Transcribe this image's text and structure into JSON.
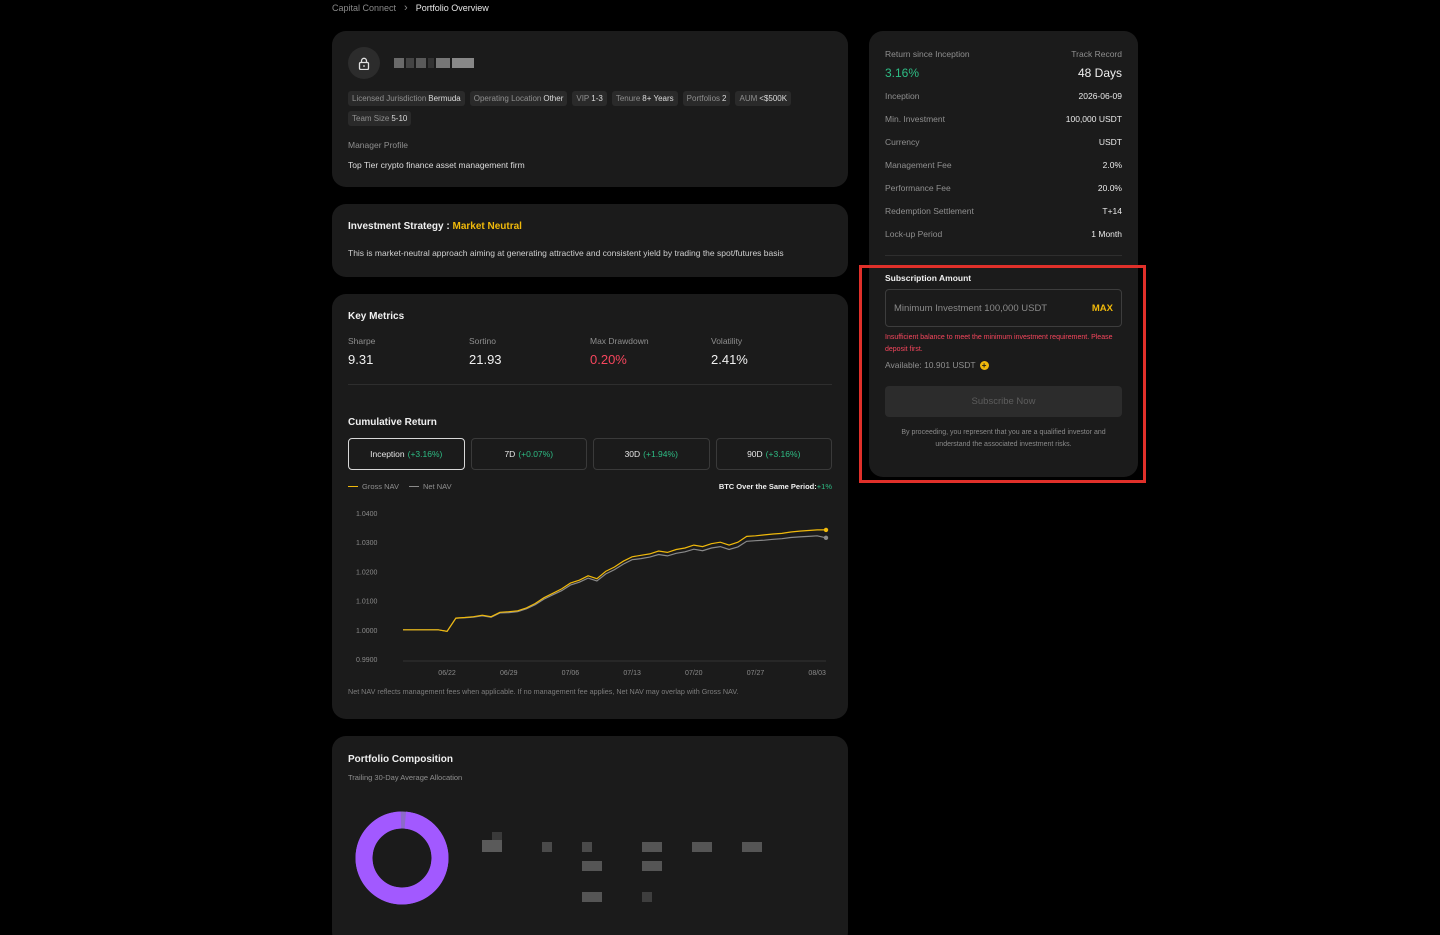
{
  "breadcrumb": {
    "root": "Capital Connect",
    "separator": "›",
    "current": "Portfolio Overview"
  },
  "profile": {
    "tags": [
      {
        "label": "Licensed Jurisdiction",
        "value": "Bermuda"
      },
      {
        "label": "Operating Location",
        "value": "Other"
      },
      {
        "label": "VIP",
        "value": "1-3"
      },
      {
        "label": "Tenure",
        "value": "8+ Years"
      },
      {
        "label": "Portfolios",
        "value": "2"
      },
      {
        "label": "AUM",
        "value": "<$500K"
      },
      {
        "label": "Team Size",
        "value": "5-10"
      }
    ],
    "manager_profile_label": "Manager Profile",
    "manager_profile_text": "Top Tier crypto finance asset management firm"
  },
  "strategy": {
    "title": "Investment Strategy :",
    "name": "Market Neutral",
    "description": "This is market-neutral approach aiming at generating attractive and consistent yield by trading the spot/futures basis"
  },
  "metrics": {
    "title": "Key Metrics",
    "items": [
      {
        "label": "Sharpe",
        "value": "9.31"
      },
      {
        "label": "Sortino",
        "value": "21.93"
      },
      {
        "label": "Max Drawdown",
        "value": "0.20%"
      },
      {
        "label": "Volatility",
        "value": "2.41%"
      }
    ]
  },
  "cumulative": {
    "title": "Cumulative Return",
    "periods": [
      {
        "label": "Inception",
        "change": "(+3.16%)"
      },
      {
        "label": "7D",
        "change": "(+0.07%)"
      },
      {
        "label": "30D",
        "change": "(+1.94%)"
      },
      {
        "label": "90D",
        "change": "(+3.16%)"
      }
    ],
    "legend_gross": "Gross NAV",
    "legend_net": "Net NAV",
    "btc_label": "BTC Over the Same Period:",
    "btc_value": "+1%",
    "note": "Net NAV reflects management fees when applicable. If no management fee applies, Net NAV may overlap with Gross NAV."
  },
  "chart_data": {
    "type": "line",
    "title": "",
    "xlabel": "",
    "ylabel": "",
    "ylim": [
      0.99,
      1.04
    ],
    "yticks": [
      "1.0400",
      "1.0300",
      "1.0200",
      "1.0100",
      "1.0000",
      "0.9900"
    ],
    "xticks": [
      "06/22",
      "06/29",
      "07/06",
      "07/13",
      "07/20",
      "07/27",
      "08/03"
    ],
    "x": [
      "06/17",
      "06/18",
      "06/19",
      "06/20",
      "06/21",
      "06/22",
      "06/23",
      "06/24",
      "06/25",
      "06/26",
      "06/27",
      "06/28",
      "06/29",
      "06/30",
      "07/01",
      "07/02",
      "07/03",
      "07/04",
      "07/05",
      "07/06",
      "07/07",
      "07/08",
      "07/09",
      "07/10",
      "07/11",
      "07/12",
      "07/13",
      "07/14",
      "07/15",
      "07/16",
      "07/17",
      "07/18",
      "07/19",
      "07/20",
      "07/21",
      "07/22",
      "07/23",
      "07/24",
      "07/25",
      "07/26",
      "07/27",
      "07/28",
      "07/29",
      "07/30",
      "07/31",
      "08/01",
      "08/02",
      "08/03",
      "08/04"
    ],
    "series": [
      {
        "name": "Gross NAV",
        "color": "#f0b90b",
        "values": [
          1.0,
          1.0,
          1.0,
          1.0,
          1.0,
          0.9995,
          1.004,
          1.0042,
          1.0045,
          1.005,
          1.0045,
          1.006,
          1.0062,
          1.0065,
          1.0075,
          1.009,
          1.011,
          1.0125,
          1.014,
          1.016,
          1.017,
          1.0185,
          1.0175,
          1.02,
          1.0215,
          1.0235,
          1.025,
          1.0255,
          1.026,
          1.027,
          1.0265,
          1.0275,
          1.028,
          1.029,
          1.0285,
          1.0295,
          1.03,
          1.029,
          1.03,
          1.032,
          1.0322,
          1.0325,
          1.0328,
          1.033,
          1.0335,
          1.0338,
          1.034,
          1.0342,
          1.0342
        ]
      },
      {
        "name": "Net NAV",
        "color": "#8a8a8a",
        "values": [
          1.0,
          1.0,
          1.0,
          1.0,
          1.0,
          0.9995,
          1.004,
          1.0041,
          1.0043,
          1.0048,
          1.0043,
          1.0058,
          1.0059,
          1.0062,
          1.0072,
          1.0086,
          1.0105,
          1.012,
          1.0134,
          1.0153,
          1.0163,
          1.0177,
          1.0167,
          1.0191,
          1.0206,
          1.0225,
          1.024,
          1.0244,
          1.0249,
          1.0258,
          1.0253,
          1.0262,
          1.0267,
          1.0276,
          1.0271,
          1.028,
          1.0285,
          1.0275,
          1.0284,
          1.0303,
          1.0305,
          1.0307,
          1.031,
          1.0312,
          1.0316,
          1.0318,
          1.032,
          1.0322,
          1.0315
        ]
      }
    ],
    "grid": false,
    "legend": "top-left"
  },
  "composition": {
    "title": "Portfolio Composition",
    "subtitle": "Trailing 30-Day Average Allocation",
    "donut_color": "#a259ff",
    "donut_share": 0.98
  },
  "summary": {
    "return_label": "Return since Inception",
    "track_label": "Track Record",
    "return_value": "3.16%",
    "track_value": "48 Days",
    "rows": [
      {
        "key": "Inception",
        "value": "2026-06-09"
      },
      {
        "key": "Min. Investment",
        "value": "100,000 USDT"
      },
      {
        "key": "Currency",
        "value": "USDT"
      },
      {
        "key": "Management Fee",
        "value": "2.0%"
      },
      {
        "key": "Performance Fee",
        "value": "20.0%"
      },
      {
        "key": "Redemption Settlement",
        "value": "T+14"
      },
      {
        "key": "Lock-up Period",
        "value": "1 Month"
      }
    ],
    "subscription_label": "Subscription Amount",
    "input_placeholder": "Minimum Investment 100,000 USDT",
    "input_value": "",
    "max_label": "MAX",
    "error_text": "Insufficient balance to meet the minimum investment requirement. Please deposit first.",
    "available_text": "Available: 10.901 USDT",
    "subscribe_label": "Subscribe Now",
    "disclaimer": "By proceeding, you represent that you are a qualified investor and understand the associated investment risks."
  },
  "colors": {
    "accent": "#f0b90b",
    "positive": "#2ebd85",
    "negative": "#f6465d",
    "highlight": "#e0302a"
  }
}
